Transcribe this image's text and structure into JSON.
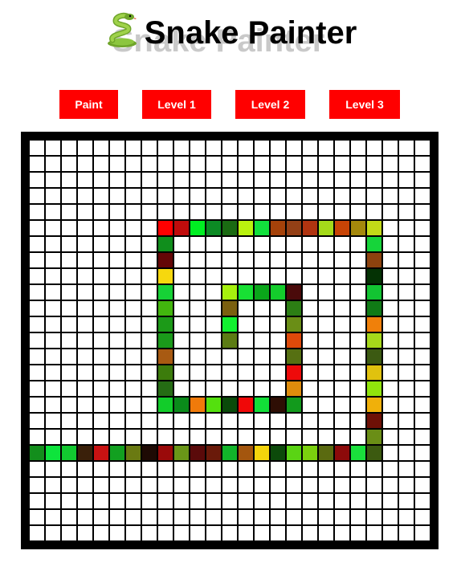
{
  "header": {
    "title": "Snake Painter",
    "icon": "snake-icon"
  },
  "toolbar": {
    "buttons": [
      {
        "label": "Paint"
      },
      {
        "label": "Level 1"
      },
      {
        "label": "Level 2"
      },
      {
        "label": "Level 3"
      }
    ],
    "button_color": "#ff0000"
  },
  "board": {
    "rows": 25,
    "cols": 25,
    "background": "#ffffff",
    "grid_color": "#000000",
    "painted_cells": [
      {
        "r": 5,
        "c": 8,
        "color": "#ff0000"
      },
      {
        "r": 5,
        "c": 9,
        "color": "#c00c0c"
      },
      {
        "r": 5,
        "c": 10,
        "color": "#00ee22"
      },
      {
        "r": 5,
        "c": 11,
        "color": "#0c8a24"
      },
      {
        "r": 5,
        "c": 12,
        "color": "#1a6a12"
      },
      {
        "r": 5,
        "c": 13,
        "color": "#b9f20f"
      },
      {
        "r": 5,
        "c": 14,
        "color": "#12e03c"
      },
      {
        "r": 5,
        "c": 15,
        "color": "#a5420a"
      },
      {
        "r": 5,
        "c": 16,
        "color": "#944016"
      },
      {
        "r": 5,
        "c": 17,
        "color": "#b03410"
      },
      {
        "r": 5,
        "c": 18,
        "color": "#a4da1a"
      },
      {
        "r": 5,
        "c": 19,
        "color": "#c84406"
      },
      {
        "r": 5,
        "c": 20,
        "color": "#a4880c"
      },
      {
        "r": 5,
        "c": 21,
        "color": "#c2da18"
      },
      {
        "r": 6,
        "c": 8,
        "color": "#108e1c"
      },
      {
        "r": 6,
        "c": 21,
        "color": "#16d43a"
      },
      {
        "r": 7,
        "c": 8,
        "color": "#640606"
      },
      {
        "r": 7,
        "c": 21,
        "color": "#8c420e"
      },
      {
        "r": 8,
        "c": 8,
        "color": "#f6d80e"
      },
      {
        "r": 8,
        "c": 21,
        "color": "#043204"
      },
      {
        "r": 9,
        "c": 8,
        "color": "#16d236"
      },
      {
        "r": 9,
        "c": 21,
        "color": "#12c432"
      },
      {
        "r": 10,
        "c": 8,
        "color": "#42b60e"
      },
      {
        "r": 10,
        "c": 21,
        "color": "#107a16"
      },
      {
        "r": 11,
        "c": 8,
        "color": "#1c9a18"
      },
      {
        "r": 11,
        "c": 21,
        "color": "#f0800a"
      },
      {
        "r": 12,
        "c": 8,
        "color": "#1a9a1a"
      },
      {
        "r": 12,
        "c": 21,
        "color": "#a6d81a"
      },
      {
        "r": 13,
        "c": 8,
        "color": "#a85a12"
      },
      {
        "r": 13,
        "c": 21,
        "color": "#3c5a12"
      },
      {
        "r": 14,
        "c": 8,
        "color": "#3c7c0c"
      },
      {
        "r": 14,
        "c": 21,
        "color": "#e0c20e"
      },
      {
        "r": 15,
        "c": 8,
        "color": "#256c14"
      },
      {
        "r": 15,
        "c": 21,
        "color": "#90e40c"
      },
      {
        "r": 16,
        "c": 21,
        "color": "#f0b00a"
      },
      {
        "r": 17,
        "c": 21,
        "color": "#6e1006"
      },
      {
        "r": 18,
        "c": 21,
        "color": "#6a8e16"
      },
      {
        "r": 16,
        "c": 8,
        "color": "#12cc2a"
      },
      {
        "r": 16,
        "c": 9,
        "color": "#0a8a1a"
      },
      {
        "r": 16,
        "c": 10,
        "color": "#f07a0a"
      },
      {
        "r": 16,
        "c": 11,
        "color": "#54e00e"
      },
      {
        "r": 16,
        "c": 12,
        "color": "#0a4a0a"
      },
      {
        "r": 16,
        "c": 13,
        "color": "#f00808"
      },
      {
        "r": 16,
        "c": 14,
        "color": "#12de38"
      },
      {
        "r": 16,
        "c": 15,
        "color": "#2e0e04"
      },
      {
        "r": 16,
        "c": 16,
        "color": "#129a1c"
      },
      {
        "r": 9,
        "c": 12,
        "color": "#a6f00e"
      },
      {
        "r": 9,
        "c": 13,
        "color": "#18e034"
      },
      {
        "r": 9,
        "c": 14,
        "color": "#0aa61a"
      },
      {
        "r": 9,
        "c": 15,
        "color": "#14cc2c"
      },
      {
        "r": 9,
        "c": 16,
        "color": "#4a0a0a"
      },
      {
        "r": 10,
        "c": 12,
        "color": "#7a6010"
      },
      {
        "r": 10,
        "c": 16,
        "color": "#2c7e14"
      },
      {
        "r": 11,
        "c": 12,
        "color": "#12f030"
      },
      {
        "r": 11,
        "c": 16,
        "color": "#6a8e16"
      },
      {
        "r": 12,
        "c": 12,
        "color": "#5c7c14"
      },
      {
        "r": 12,
        "c": 16,
        "color": "#de4a0a"
      },
      {
        "r": 13,
        "c": 16,
        "color": "#567012"
      },
      {
        "r": 14,
        "c": 16,
        "color": "#ee0a0a"
      },
      {
        "r": 15,
        "c": 16,
        "color": "#de8c0c"
      },
      {
        "r": 19,
        "c": 0,
        "color": "#138e1c"
      },
      {
        "r": 19,
        "c": 1,
        "color": "#0ee43c"
      },
      {
        "r": 19,
        "c": 2,
        "color": "#12c830"
      },
      {
        "r": 19,
        "c": 3,
        "color": "#3a200a"
      },
      {
        "r": 19,
        "c": 4,
        "color": "#c81212"
      },
      {
        "r": 19,
        "c": 5,
        "color": "#12a020"
      },
      {
        "r": 19,
        "c": 6,
        "color": "#6a7a12"
      },
      {
        "r": 19,
        "c": 7,
        "color": "#1e0a04"
      },
      {
        "r": 19,
        "c": 8,
        "color": "#9a0a0a"
      },
      {
        "r": 19,
        "c": 9,
        "color": "#6a9618"
      },
      {
        "r": 19,
        "c": 10,
        "color": "#5a0a0a"
      },
      {
        "r": 19,
        "c": 11,
        "color": "#6a1a0a"
      },
      {
        "r": 19,
        "c": 12,
        "color": "#12b42a"
      },
      {
        "r": 19,
        "c": 13,
        "color": "#a4560e"
      },
      {
        "r": 19,
        "c": 14,
        "color": "#f4d40c"
      },
      {
        "r": 19,
        "c": 15,
        "color": "#0c4a0a"
      },
      {
        "r": 19,
        "c": 16,
        "color": "#5ad414"
      },
      {
        "r": 19,
        "c": 17,
        "color": "#7ad00e"
      },
      {
        "r": 19,
        "c": 18,
        "color": "#5a6a10"
      },
      {
        "r": 19,
        "c": 19,
        "color": "#8c0a0a"
      },
      {
        "r": 19,
        "c": 20,
        "color": "#1ae03c"
      },
      {
        "r": 19,
        "c": 21,
        "color": "#3c5a10"
      }
    ]
  }
}
